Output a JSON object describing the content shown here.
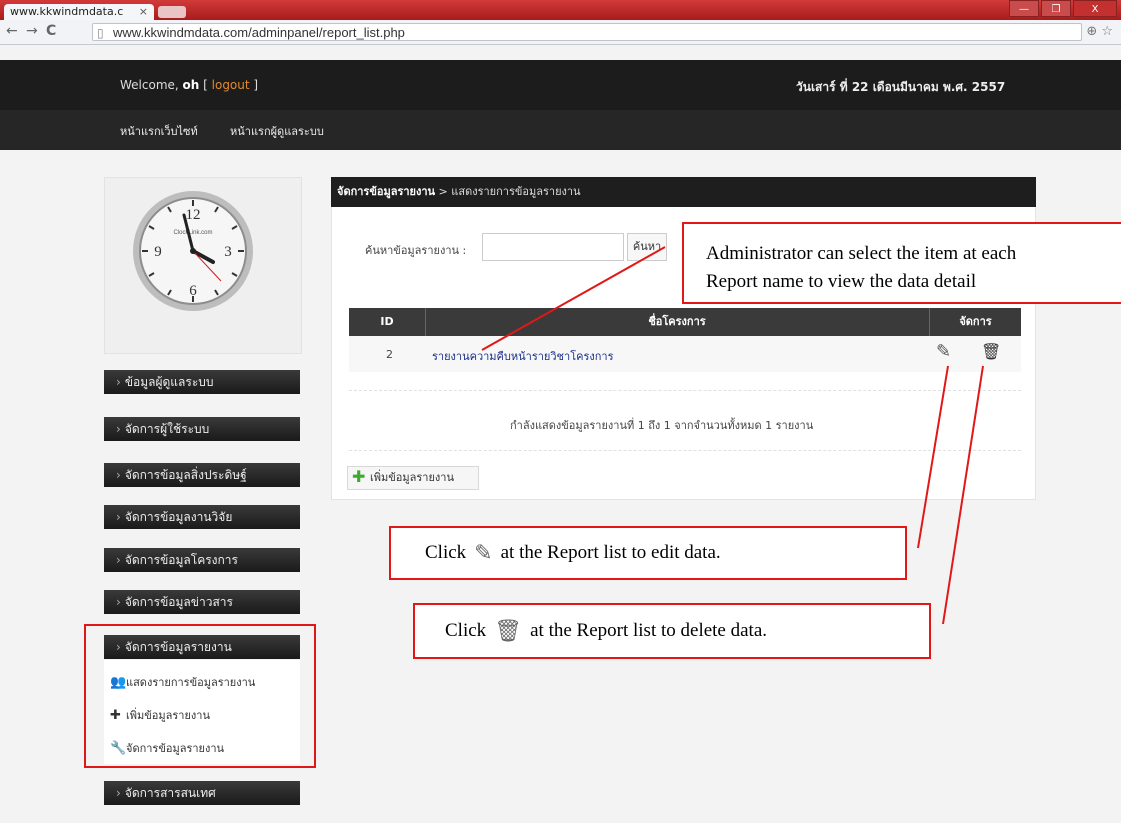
{
  "browser": {
    "tab_title": "www.kkwindmdata.c",
    "tab_close": "×",
    "back": "←",
    "forward": "→",
    "reload": "C",
    "url": "www.kkwindmdata.com/adminpanel/report_list.php",
    "addr_icons": "⊕ ☆",
    "win_min": "—",
    "win_max": "❐",
    "win_close": "X"
  },
  "header": {
    "welcome_prefix": "Welcome, ",
    "username": "oh",
    "logout_open": " [ ",
    "logout": "logout",
    "logout_close": " ]",
    "date": "วันเสาร์ ที่ 22 เดือนมีนาคม พ.ศ. 2557",
    "nav": [
      "หน้าแรกเว็บไซท์",
      "หน้าแรกผู้ดูแลระบบ"
    ]
  },
  "clock": {
    "brand": "ClockLink.com",
    "n12": "12",
    "n3": "3",
    "n6": "6",
    "n9": "9"
  },
  "sidebar": {
    "chevron": "›",
    "menu": [
      "ข้อมูลผู้ดูแลระบบ",
      "จัดการผู้ใช้ระบบ",
      "จัดการข้อมูลสิ่งประดิษฐ์",
      "จัดการข้อมูลงานวิจัย",
      "จัดการข้อมูลโครงการ",
      "จัดการข้อมูลข่าวสาร",
      "จัดการข้อมูลรายงาน",
      "จัดการสารสนเทศ"
    ],
    "submenu": [
      {
        "icon": "users-icon",
        "glyph": "👥",
        "label": "แสดงรายการข้อมูลรายงาน"
      },
      {
        "icon": "plus-icon",
        "glyph": "✚",
        "label": "เพิ่มข้อมูลรายงาน"
      },
      {
        "icon": "wrench-icon",
        "glyph": "🔧",
        "label": "จัดการข้อมูลรายงาน"
      }
    ]
  },
  "main": {
    "breadcrumb_bold": "จัดการข้อมูลรายงาน",
    "breadcrumb_rest": " > แสดงรายการข้อมูลรายงาน",
    "search_label": "ค้นหาข้อมูลรายงาน :",
    "search_value": "",
    "search_button": "ค้นหา",
    "table": {
      "headers": [
        "ID",
        "ชื่อโครงการ",
        "จัดการ"
      ],
      "rows": [
        {
          "id": "2",
          "name": "รายงานความคืบหน้ารายวิชาโครงการ"
        }
      ]
    },
    "info": "กำลังแสดงข้อมูลรายงานที่ 1 ถึง 1 จากจำนวนทั้งหมด 1 รายงาน",
    "add_button": "เพิ่มข้อมูลรายงาน",
    "add_glyph": "✚",
    "edit_glyph": "✎",
    "delete_glyph": "🗑"
  },
  "annotations": {
    "select_line1": "Administrator can select the item at each",
    "select_line2": "Report name to view the data detail",
    "edit_prefix": "Click",
    "edit_suffix": "at the Report list to edit data.",
    "delete_prefix": "Click",
    "delete_suffix": "at the Report list to delete data."
  },
  "colors": {
    "highlight": "#e01818",
    "link": "#1b2f8a",
    "logout": "#e08a2e",
    "header_bg": "#1c1c1c"
  }
}
